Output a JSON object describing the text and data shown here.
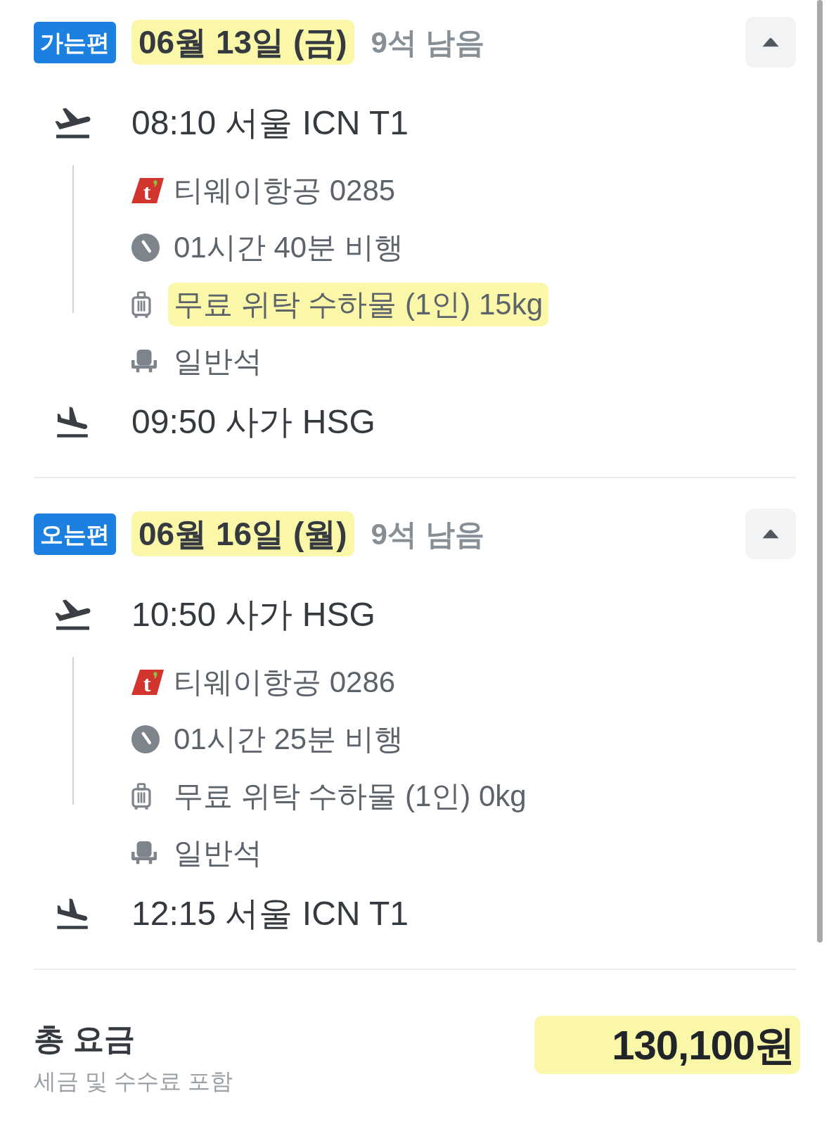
{
  "segments": [
    {
      "badge": "가는편",
      "date": {
        "text": "06월 13일 (금)",
        "highlighted": true
      },
      "seats": "9석 남음",
      "expanded": true,
      "departure": "08:10 서울 ICN T1",
      "details": [
        {
          "kind": "airline",
          "logo": "t",
          "text": "티웨이항공 0285",
          "highlighted": false
        },
        {
          "kind": "duration",
          "text": "01시간 40분 비행",
          "highlighted": false
        },
        {
          "kind": "baggage",
          "text": "무료 위탁 수하물 (1인) 15kg",
          "highlighted": true
        },
        {
          "kind": "seat",
          "text": "일반석",
          "highlighted": false
        }
      ],
      "arrival": "09:50 사가 HSG"
    },
    {
      "badge": "오는편",
      "date": {
        "text": "06월 16일 (월)",
        "highlighted": true
      },
      "seats": "9석 남음",
      "expanded": true,
      "departure": "10:50 사가 HSG",
      "details": [
        {
          "kind": "airline",
          "logo": "t",
          "text": "티웨이항공 0286",
          "highlighted": false
        },
        {
          "kind": "duration",
          "text": "01시간 25분 비행",
          "highlighted": false
        },
        {
          "kind": "baggage",
          "text": "무료 위탁 수하물 (1인) 0kg",
          "highlighted": false
        },
        {
          "kind": "seat",
          "text": "일반석",
          "highlighted": false
        }
      ],
      "arrival": "12:15 서울 ICN T1"
    }
  ],
  "total": {
    "label": "총 요금",
    "note": "세금 및 수수료 포함",
    "price": {
      "text": "130,100원",
      "highlighted": true
    }
  }
}
